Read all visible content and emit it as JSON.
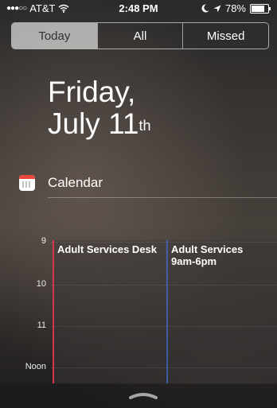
{
  "status_bar": {
    "signal": "●●●○○",
    "carrier": "AT&T",
    "time": "2:48 PM",
    "battery_text": "78%",
    "battery_level": 0.78
  },
  "segments": [
    {
      "label": "Today",
      "active": true
    },
    {
      "label": "All",
      "active": false
    },
    {
      "label": "Missed",
      "active": false
    }
  ],
  "date": {
    "weekday": "Friday,",
    "month_day": "July 11",
    "suffix": "th"
  },
  "calendar_widget": {
    "title": "Calendar",
    "hours": [
      "9",
      "10",
      "11",
      "Noon"
    ],
    "events": [
      {
        "title": "Adult Services Desk",
        "time": "",
        "color": "#d8344f"
      },
      {
        "title": "Adult Services",
        "time": "9am-6pm",
        "color": "#3f5ca8"
      }
    ]
  }
}
